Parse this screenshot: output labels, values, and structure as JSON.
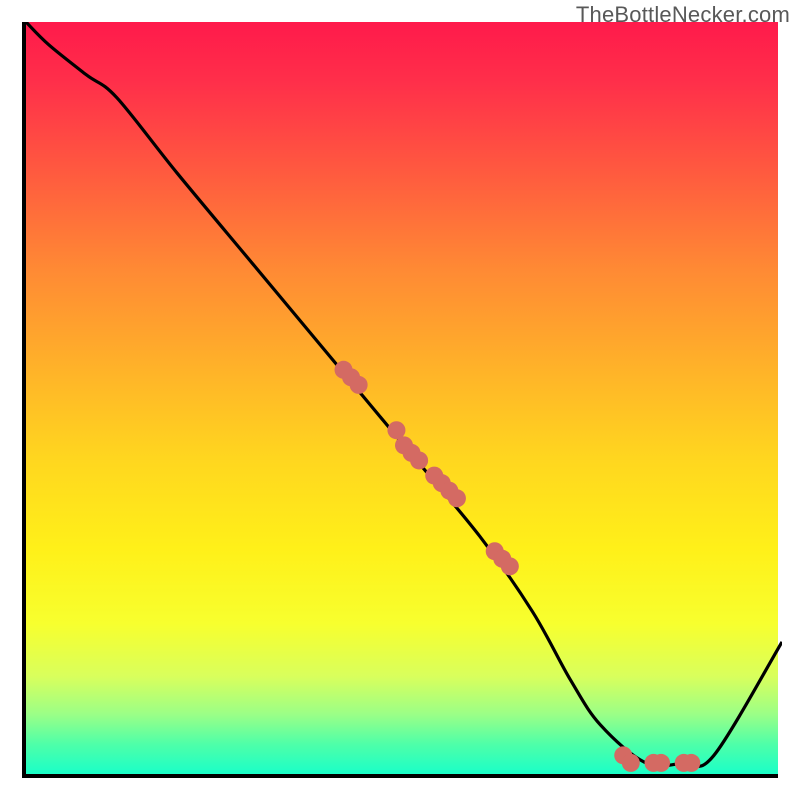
{
  "watermark": "TheBottleNecker.com",
  "chart_data": {
    "type": "line",
    "title": "",
    "xlabel": "",
    "ylabel": "",
    "xlim": [
      0,
      100
    ],
    "ylim": [
      0,
      100
    ],
    "grid": false,
    "legend": false,
    "series": [
      {
        "name": "curve",
        "x": [
          0,
          3,
          8,
          12,
          20,
          30,
          40,
          50,
          60,
          67,
          72,
          76,
          82,
          87,
          91,
          100
        ],
        "y": [
          100,
          97,
          93,
          90,
          80,
          68,
          56,
          44,
          32,
          22,
          13,
          7,
          2,
          2,
          3,
          18
        ]
      }
    ],
    "markers": {
      "name": "points-on-curve",
      "x": [
        42,
        43,
        44,
        49,
        50,
        51,
        52,
        54,
        55,
        56,
        57,
        62,
        63,
        64,
        79,
        80,
        83,
        84,
        87,
        88
      ],
      "y": [
        54,
        53,
        52,
        46,
        44,
        43,
        42,
        40,
        39,
        38,
        37,
        30,
        29,
        28,
        3,
        2,
        2,
        2,
        2,
        2
      ]
    }
  }
}
